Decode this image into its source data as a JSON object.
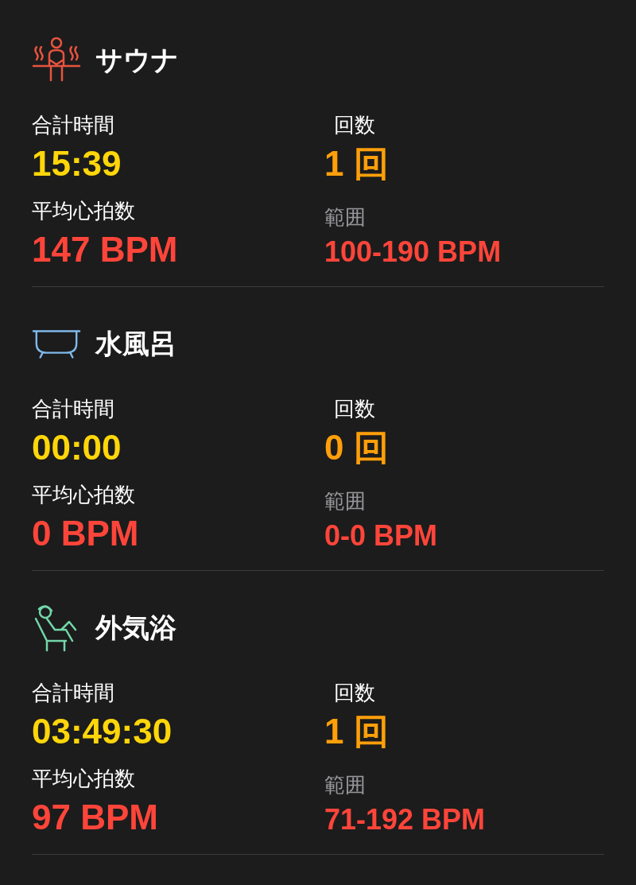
{
  "sections": [
    {
      "kind": "sauna",
      "title": "サウナ",
      "total_time": {
        "label": "合計時間",
        "value": "15:39"
      },
      "count": {
        "label": "回数",
        "value": "1 回"
      },
      "avg_hr": {
        "label": "平均心拍数",
        "value": "147 BPM"
      },
      "range": {
        "label": "範囲",
        "value": "100-190 BPM"
      }
    },
    {
      "kind": "cold_bath",
      "title": "水風呂",
      "total_time": {
        "label": "合計時間",
        "value": "00:00"
      },
      "count": {
        "label": "回数",
        "value": "0 回"
      },
      "avg_hr": {
        "label": "平均心拍数",
        "value": "0 BPM"
      },
      "range": {
        "label": "範囲",
        "value": "0-0 BPM"
      }
    },
    {
      "kind": "outdoor_rest",
      "title": "外気浴",
      "total_time": {
        "label": "合計時間",
        "value": "03:49:30"
      },
      "count": {
        "label": "回数",
        "value": "1 回"
      },
      "avg_hr": {
        "label": "平均心拍数",
        "value": "97 BPM"
      },
      "range": {
        "label": "範囲",
        "value": "71-192 BPM"
      }
    }
  ]
}
